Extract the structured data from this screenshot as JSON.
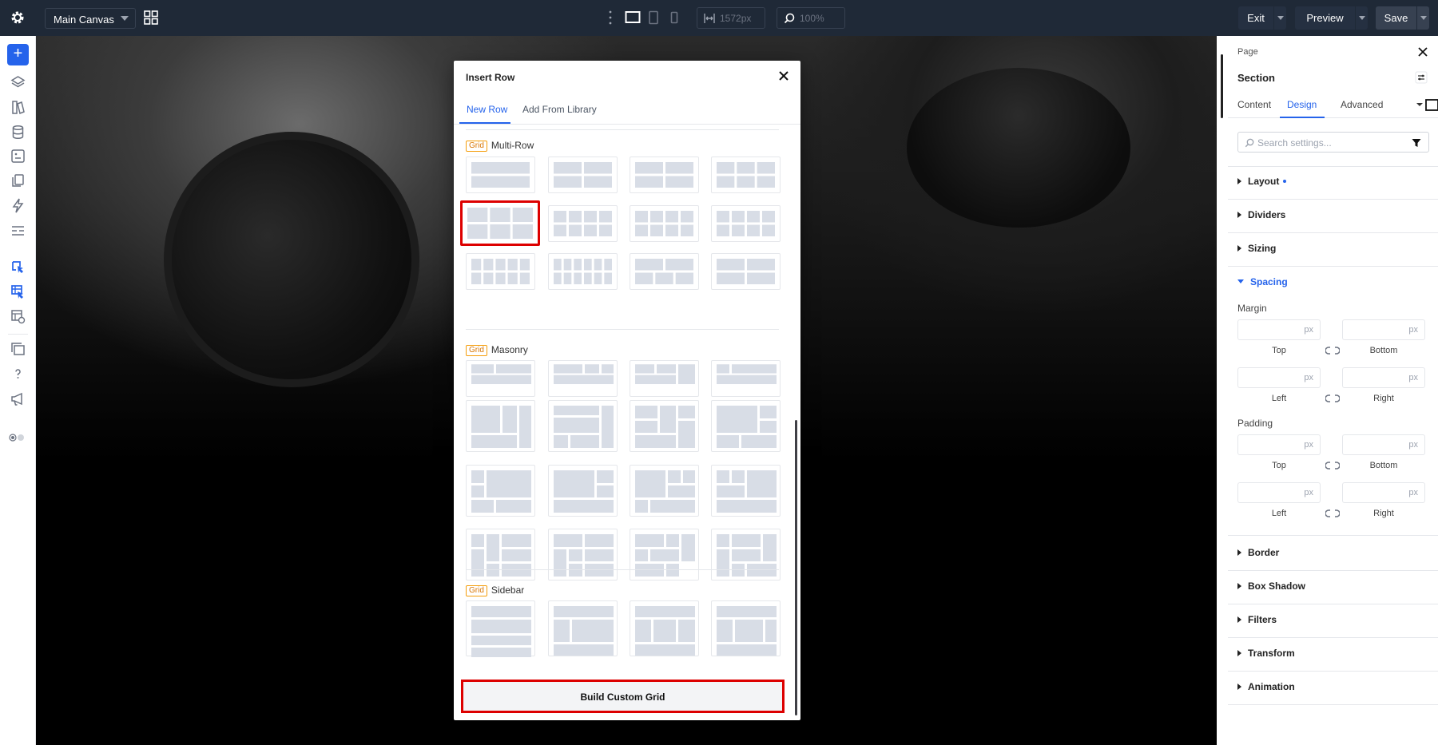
{
  "topbar": {
    "canvas_name": "Main Canvas",
    "width_value": "1572px",
    "zoom_value": "100%",
    "exit_label": "Exit",
    "preview_label": "Preview",
    "save_label": "Save"
  },
  "modal": {
    "title": "Insert Row",
    "tabs": [
      "New Row",
      "Add From Library"
    ],
    "active_tab": "New Row",
    "badge": "Grid",
    "sections": [
      {
        "name": "Multi-Row",
        "tile_rows": 3
      },
      {
        "name": "Masonry",
        "tile_rows": 4
      },
      {
        "name": "Sidebar",
        "tile_rows": 1
      }
    ],
    "build_button": "Build Custom Grid"
  },
  "panel": {
    "breadcrumb": "Page",
    "element": "Section",
    "tabs": [
      "Content",
      "Design",
      "Advanced"
    ],
    "active_tab": "Design",
    "search_placeholder": "Search settings...",
    "accordions": {
      "layout": "Layout",
      "dividers": "Dividers",
      "sizing": "Sizing",
      "spacing": "Spacing",
      "border": "Border",
      "box_shadow": "Box Shadow",
      "filters": "Filters",
      "transform": "Transform",
      "animation": "Animation"
    },
    "spacing": {
      "margin_label": "Margin",
      "padding_label": "Padding",
      "unit": "px",
      "top": "Top",
      "bottom": "Bottom",
      "left": "Left",
      "right": "Right"
    }
  },
  "colors": {
    "accent": "#2563eb",
    "highlight": "#dd0000",
    "badge": "#d97706",
    "topbar": "#1f2937"
  }
}
